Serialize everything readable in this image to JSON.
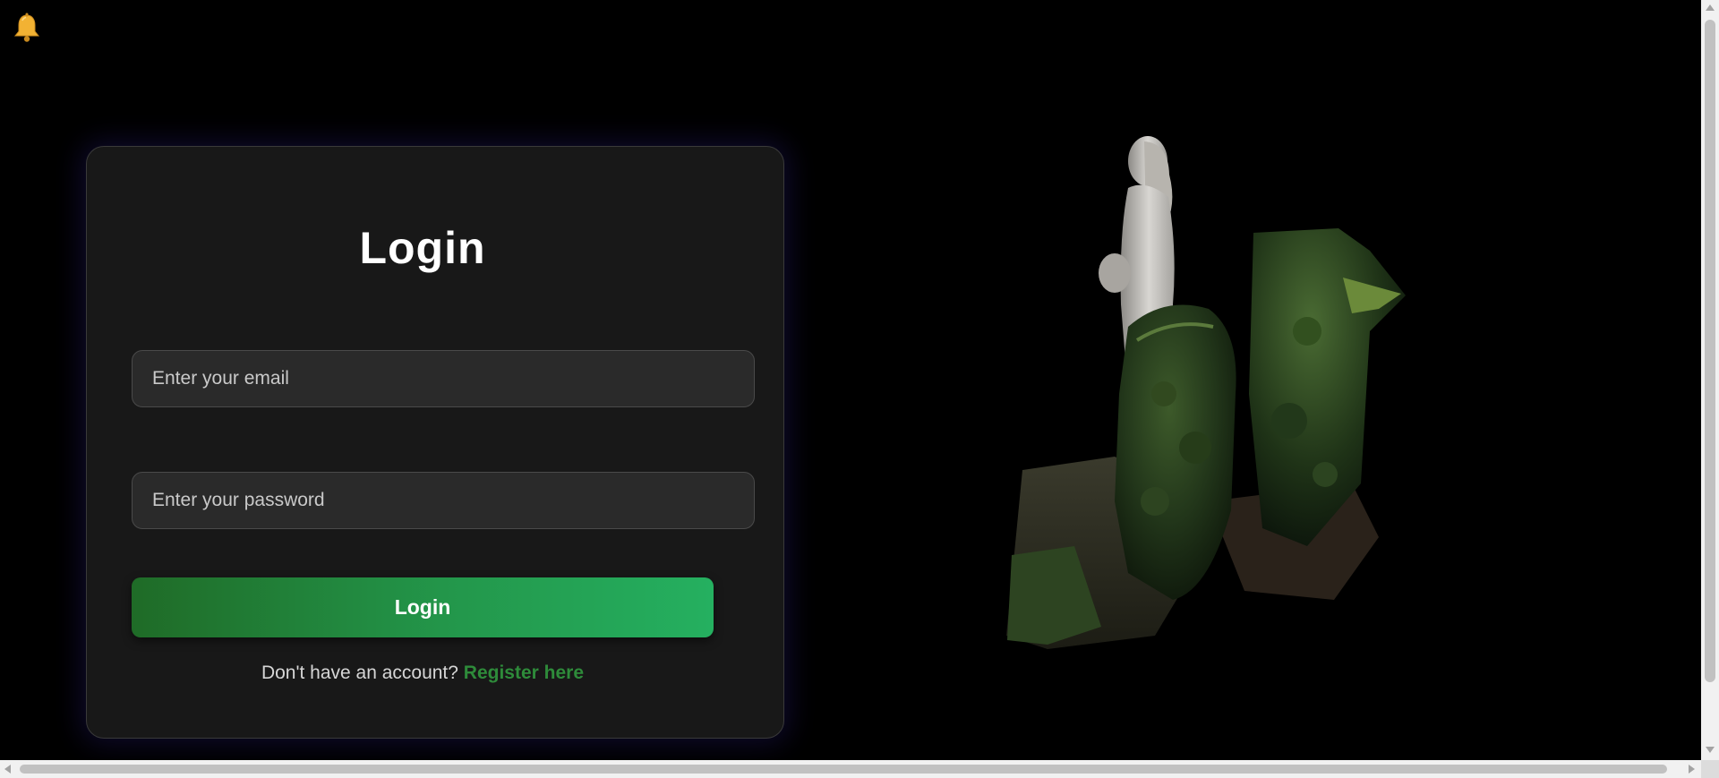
{
  "notification": {
    "icon": "bell-icon",
    "color": "#f2b233"
  },
  "login": {
    "title": "Login",
    "email_placeholder": "Enter your email",
    "password_placeholder": "Enter your password",
    "submit_label": "Login",
    "register_prompt": "Don't have an account?",
    "register_link": "Register here"
  },
  "colors": {
    "background": "#000000",
    "card": "#181818",
    "accent_green": "#23974b",
    "link_green": "#2e8b3a"
  }
}
